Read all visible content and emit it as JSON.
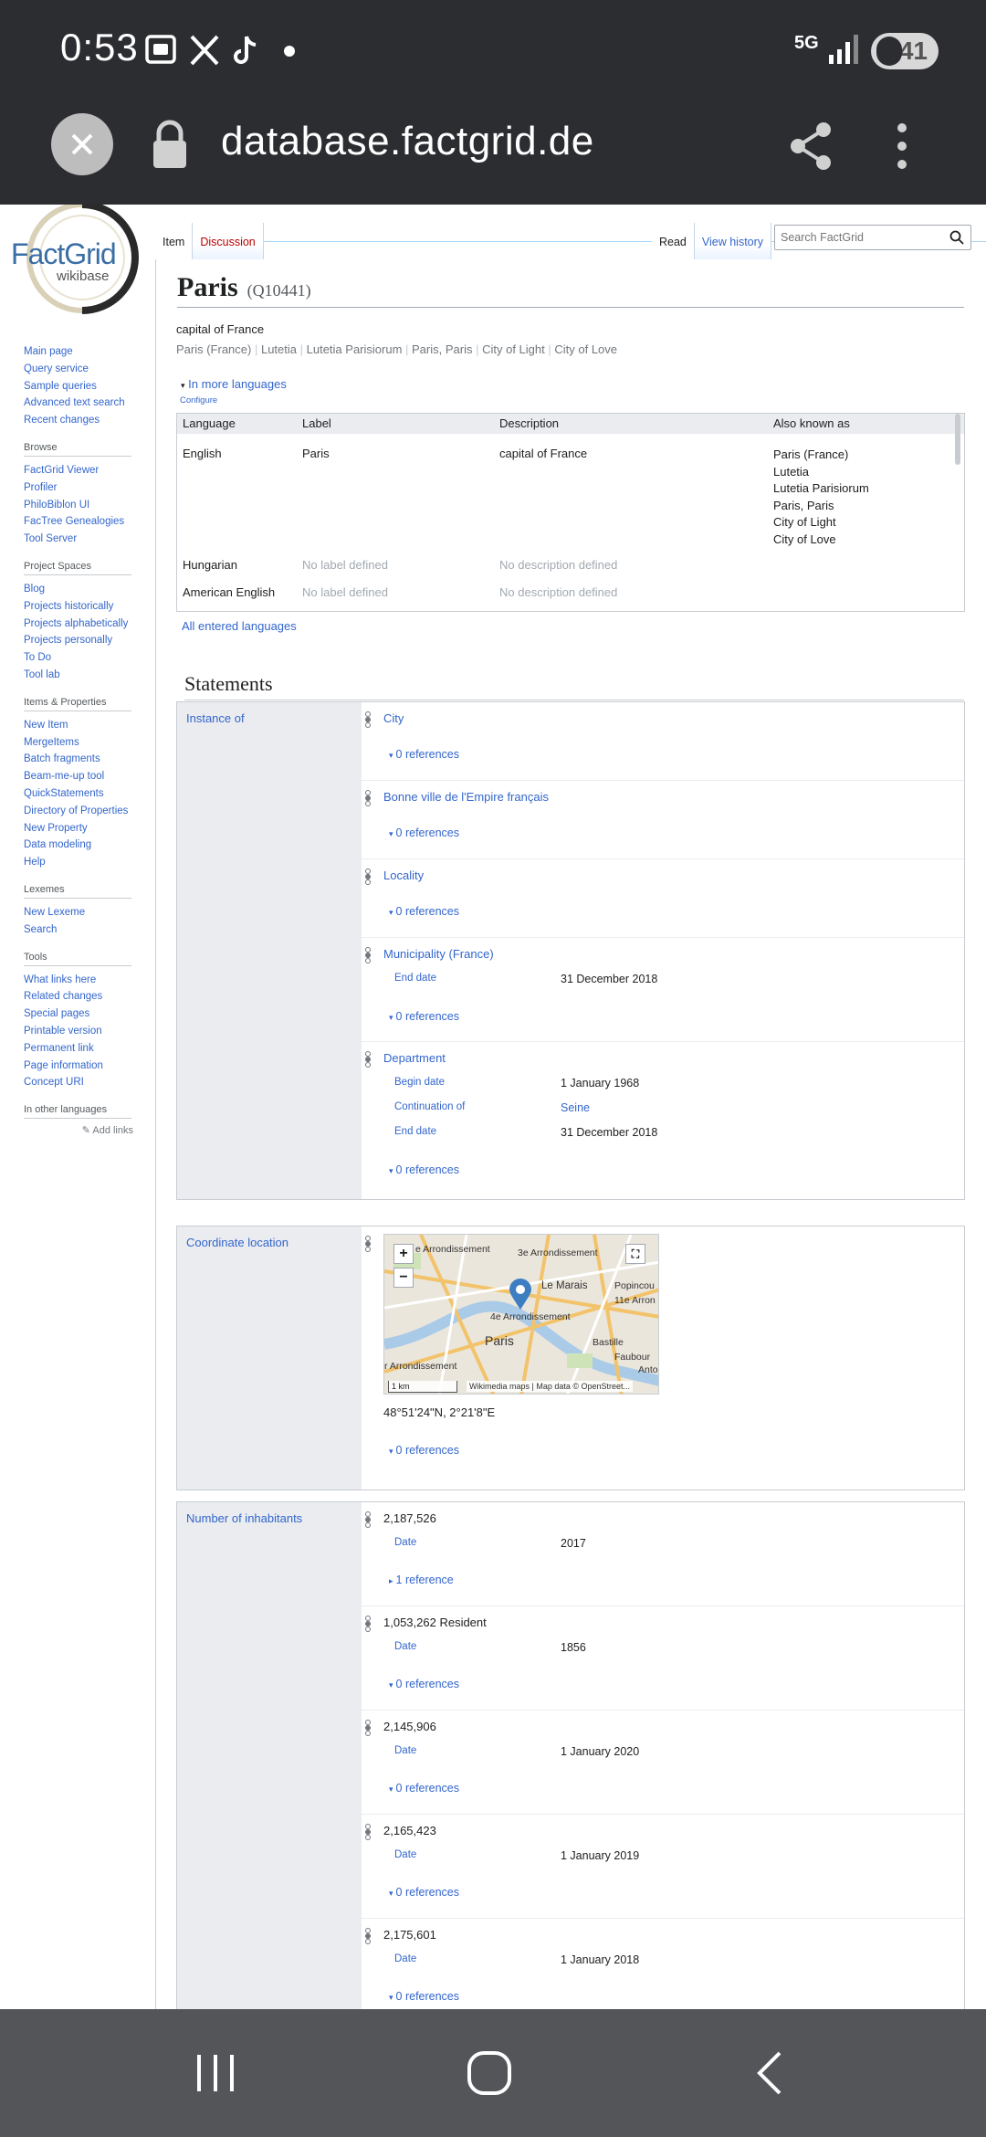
{
  "status_bar": {
    "time": "0:53",
    "network": "5G",
    "battery": "41",
    "notification_icons": [
      "screenshot-icon",
      "x-icon",
      "tiktok-icon",
      "dot-icon"
    ]
  },
  "browser": {
    "url": "database.factgrid.de"
  },
  "logo": {
    "name": "FactGrid",
    "sub": "wikibase"
  },
  "sidebar": {
    "main": [
      "Main page",
      "Query service",
      "Sample queries",
      "Advanced text search",
      "Recent changes"
    ],
    "browse_title": "Browse",
    "browse": [
      "FactGrid Viewer",
      "Profiler",
      "PhiloBiblon UI",
      "FacTree Genealogies",
      "Tool Server"
    ],
    "projects_title": "Project Spaces",
    "projects": [
      "Blog",
      "Projects historically",
      "Projects alphabetically",
      "Projects personally",
      "To Do",
      "Tool lab"
    ],
    "items_title": "Items & Properties",
    "items": [
      "New Item",
      "MergeItems",
      "Batch fragments",
      "Beam-me-up tool",
      "QuickStatements",
      "Directory of Properties",
      "New Property",
      "Data modeling",
      "Help"
    ],
    "lexemes_title": "Lexemes",
    "lexemes": [
      "New Lexeme",
      "Search"
    ],
    "tools_title": "Tools",
    "tools": [
      "What links here",
      "Related changes",
      "Special pages",
      "Printable version",
      "Permanent link",
      "Page information",
      "Concept URI"
    ],
    "languages_title": "In other languages",
    "add_links": "Add links"
  },
  "tabs": {
    "item": "Item",
    "discussion": "Discussion",
    "read": "Read",
    "history": "View history",
    "search_placeholder": "Search FactGrid"
  },
  "entity": {
    "title": "Paris",
    "qid": "(Q10441)",
    "description": "capital of France",
    "aliases": [
      "Paris (France)",
      "Lutetia",
      "Lutetia Parisiorum",
      "Paris, Paris",
      "City of Light",
      "City of Love"
    ],
    "more_languages": "In more languages",
    "configure": "Configure",
    "all_languages": "All entered languages"
  },
  "lang_table": {
    "headers": [
      "Language",
      "Label",
      "Description",
      "Also known as"
    ],
    "rows": [
      {
        "language": "English",
        "label": "Paris",
        "description": "capital of France",
        "aliases": [
          "Paris (France)",
          "Lutetia",
          "Lutetia Parisiorum",
          "Paris, Paris",
          "City of Light",
          "City of Love"
        ]
      },
      {
        "language": "Hungarian",
        "label": "No label defined",
        "description": "No description defined",
        "aliases": []
      },
      {
        "language": "American English",
        "label": "No label defined",
        "description": "No description defined",
        "aliases": []
      }
    ]
  },
  "statements_title": "Statements",
  "instance_of": {
    "property": "Instance of",
    "values": [
      {
        "value": "City",
        "refs": "0 references"
      },
      {
        "value": "Bonne ville de l'Empire français",
        "refs": "0 references"
      },
      {
        "value": "Locality",
        "refs": "0 references"
      },
      {
        "value": "Municipality (France)",
        "qualifiers": [
          {
            "p": "End date",
            "v": "31 December 2018"
          }
        ],
        "refs": "0 references"
      },
      {
        "value": "Department",
        "qualifiers": [
          {
            "p": "Begin date",
            "v": "1 January 1968"
          },
          {
            "p": "Continuation of",
            "v": "Seine"
          },
          {
            "p": "End date",
            "v": "31 December 2018"
          }
        ],
        "refs": "0 references"
      }
    ]
  },
  "coordinate": {
    "property": "Coordinate location",
    "value": "48°51'24\"N, 2°21'8\"E",
    "refs": "0 references",
    "map": {
      "zoom_in": "+",
      "zoom_out": "−",
      "labels": [
        "e Arrondissement",
        "3e Arrondissement",
        "Le Marais",
        "Popincou",
        "11e Arron",
        "4e Arrondissement",
        "Paris",
        "Bastille",
        "Faubour",
        "Anto",
        "r Arrondissement"
      ],
      "scale": "1 km",
      "attribution": "Wikimedia maps | Map data © OpenStreet..."
    }
  },
  "inhabitants": {
    "property": "Number of inhabitants",
    "values": [
      {
        "value": "2,187,526",
        "date_label": "Date",
        "date": "2017",
        "refs": "1 reference"
      },
      {
        "value": "1,053,262 Resident",
        "date_label": "Date",
        "date": "1856",
        "refs": "0 references"
      },
      {
        "value": "2,145,906",
        "date_label": "Date",
        "date": "1 January 2020",
        "refs": "0 references"
      },
      {
        "value": "2,165,423",
        "date_label": "Date",
        "date": "1 January 2019",
        "refs": "0 references"
      },
      {
        "value": "2,175,601",
        "date_label": "Date",
        "date": "1 January 2018",
        "refs": "0 references"
      }
    ]
  },
  "colors": {
    "link": "#3366cc",
    "status_bar": "#2c2d31",
    "nav_bar": "#545558",
    "property_bg": "#eaecf0"
  }
}
